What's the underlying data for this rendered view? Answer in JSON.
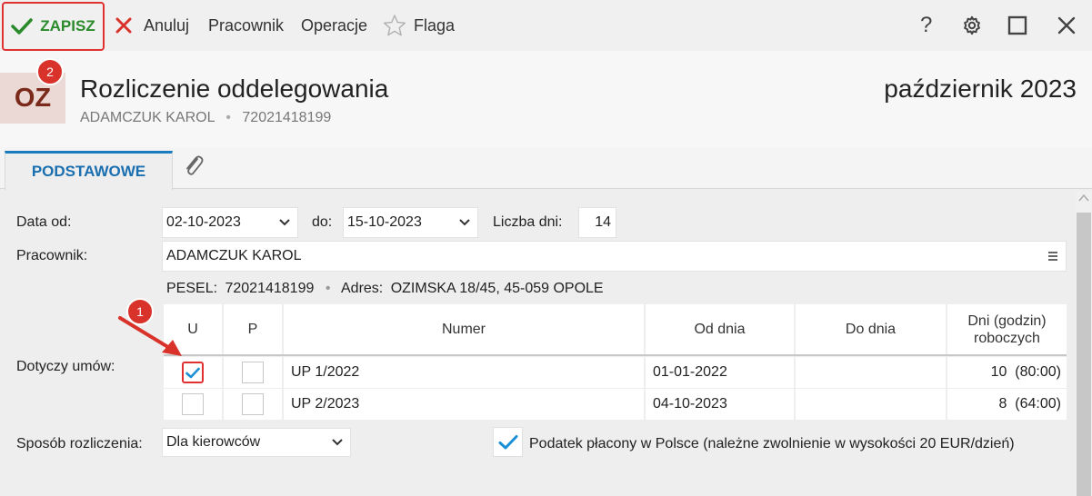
{
  "toolbar": {
    "save_label": "ZAPISZ",
    "cancel_label": "Anuluj",
    "employee_label": "Pracownik",
    "operations_label": "Operacje",
    "flag_label": "Flaga",
    "help_label": "?"
  },
  "header": {
    "avatar_text": "OZ",
    "title": "Rozliczenie oddelegowania",
    "period": "październik 2023",
    "employee_name": "ADAMCZUK KAROL",
    "separator": "•",
    "pesel": "72021418199"
  },
  "tabs": {
    "basic_label": "PODSTAWOWE"
  },
  "form": {
    "date_from_label": "Data od:",
    "date_from_value": "02-10-2023",
    "date_to_label": "do:",
    "date_to_value": "15-10-2023",
    "days_label": "Liczba dni:",
    "days_value": "14",
    "employee_label": "Pracownik:",
    "employee_value": "ADAMCZUK KAROL",
    "pesel_label": "PESEL:",
    "pesel_value": "72021418199",
    "bullet": "•",
    "address_label": "Adres:",
    "address_value": "OZIMSKA 18/45, 45-059 OPOLE",
    "contracts_label": "Dotyczy umów:",
    "settlement_label": "Sposób rozliczenia:",
    "settlement_value": "Dla kierowców",
    "tax_label": "Podatek płacony w Polsce (należne zwolnienie w wysokości 20 EUR/dzień)",
    "tax_checked": true
  },
  "table": {
    "headers": {
      "u": "U",
      "p": "P",
      "numer": "Numer",
      "od": "Od dnia",
      "do": "Do dnia",
      "dni_line1": "Dni (godzin)",
      "dni_line2": "roboczych"
    },
    "rows": [
      {
        "u": true,
        "p": false,
        "numer": "UP 1/2022",
        "od": "01-01-2022",
        "do": "",
        "dni": "10  (80:00)"
      },
      {
        "u": false,
        "p": false,
        "numer": "UP 2/2023",
        "od": "04-10-2023",
        "do": "",
        "dni": "8  (64:00)"
      }
    ]
  },
  "annotations": {
    "step1": "1",
    "step2": "2"
  },
  "colors": {
    "accent_blue": "#1a7bbf",
    "save_green": "#2b8a2b",
    "highlight_red": "#e03030",
    "check_blue": "#1a8fd6"
  },
  "icons": [
    "check-icon",
    "close-icon",
    "star-icon",
    "help-icon",
    "gear-icon",
    "maximize-icon",
    "window-close-icon",
    "paperclip-icon",
    "chevron-down-icon",
    "menu-icon",
    "arrow-icon"
  ]
}
